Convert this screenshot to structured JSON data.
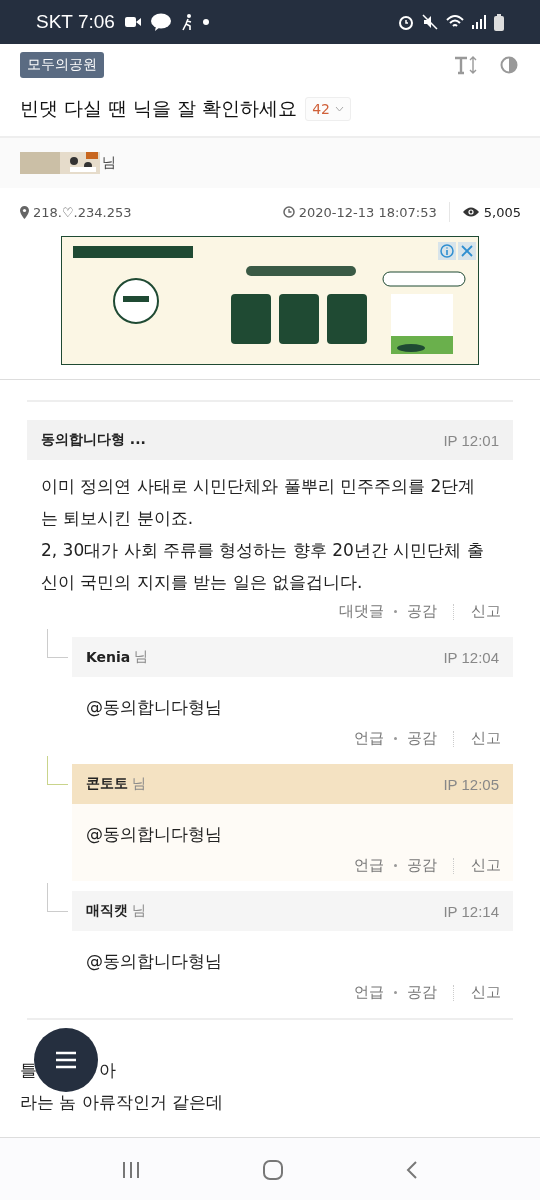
{
  "status_bar": {
    "carrier_time": "SKT 7:06"
  },
  "header": {
    "board_tag": "모두의공원",
    "title": "빈댓 다실 땐 닉을 잘 확인하세요",
    "comment_count": "42"
  },
  "author": {
    "suffix": "님"
  },
  "meta": {
    "ip": "218.♡.234.253",
    "datetime": "2020-12-13 18:07:53",
    "views": "5,005"
  },
  "comments": [
    {
      "kind": "comment",
      "nick": "동의합니다형 ...",
      "time": "IP 12:01",
      "highlighted": false,
      "body": "이미 정의연 사태로 시민단체와 풀뿌리 민주주의를 2단계는 퇴보시킨 분이죠.\n2, 30대가 사회 주류를 형성하는 향후 20년간 시민단체 출신이 국민의 지지를 받는 일은 없을겁니다.",
      "actions": [
        "대댓글",
        "공감",
        "신고"
      ]
    },
    {
      "kind": "reply",
      "nick": "Kenia",
      "suffix": "님",
      "time": "IP 12:04",
      "highlighted": false,
      "body": "@동의합니다형님",
      "actions": [
        "언급",
        "공감",
        "신고"
      ]
    },
    {
      "kind": "reply",
      "nick": "콘토토",
      "suffix": "님",
      "time": "IP 12:05",
      "highlighted": true,
      "body": "@동의합니다형님",
      "actions": [
        "언급",
        "공감",
        "신고"
      ]
    },
    {
      "kind": "reply",
      "nick": "매직캣",
      "suffix": "님",
      "time": "IP 12:14",
      "highlighted": false,
      "body": "@동의합니다형님",
      "actions": [
        "언급",
        "공감",
        "신고"
      ]
    }
  ],
  "next_post": {
    "line_1_start": "틀",
    "line_1_end": "아",
    "line_2": "라는 놈 아류작인거 같은데"
  }
}
